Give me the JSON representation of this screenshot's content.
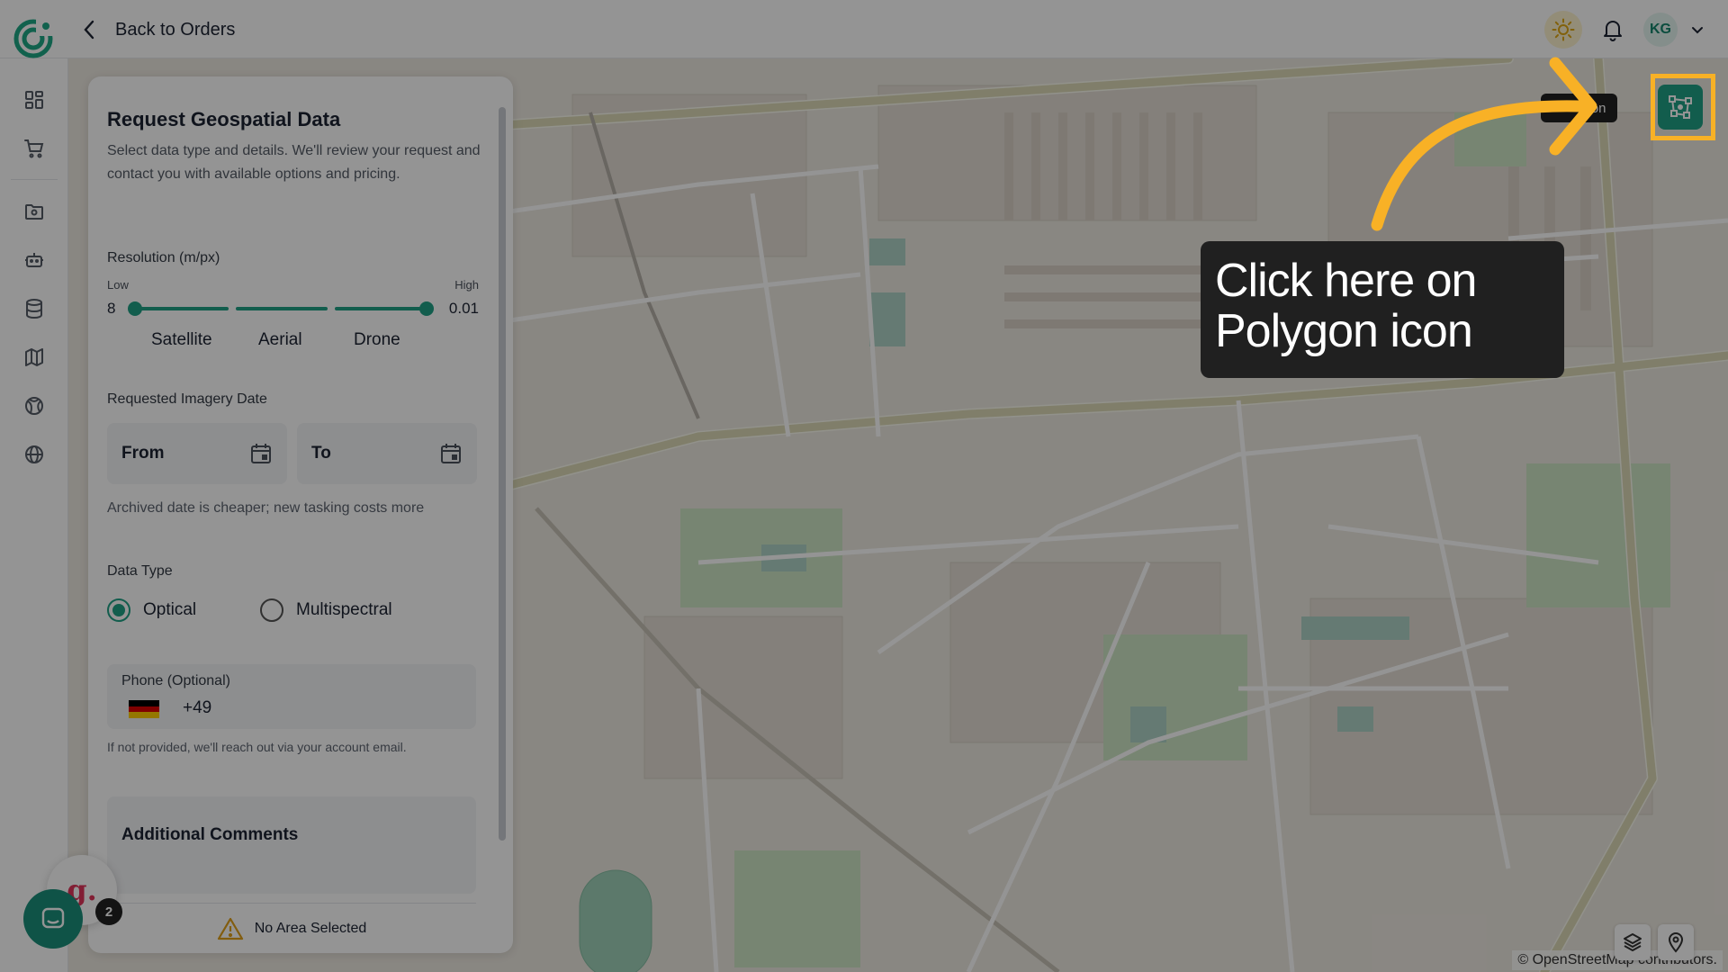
{
  "header": {
    "back_label": "Back to Orders",
    "avatar_initials": "KG"
  },
  "icons": {
    "logo": "brand-logo-icon",
    "back": "chevron-left-icon",
    "theme": "sun-icon",
    "notifications": "bell-icon",
    "account_menu": "chevron-down-icon",
    "rail": [
      "dashboard-icon",
      "cart-icon",
      "folder-icon",
      "robot-icon",
      "database-icon",
      "map-icon",
      "globe-grid-icon",
      "globe-icon"
    ],
    "polygon": "polygon-draw-icon",
    "layers": "layers-icon",
    "location": "location-pin-icon",
    "warning": "warning-icon",
    "calendar": "calendar-icon",
    "chat": "chat-icon"
  },
  "map": {
    "polygon_tooltip": "ygon",
    "attribution": "© OpenStreetMap contributors."
  },
  "panel": {
    "title": "Request Geospatial Data",
    "description": "Select data type and details. We'll review your request and contact you with available options and pricing.",
    "resolution": {
      "label": "Resolution (m/px)",
      "low_label": "Low",
      "high_label": "High",
      "min_value": "8",
      "max_value": "0.01",
      "ticks": [
        "Satellite",
        "Aerial",
        "Drone"
      ]
    },
    "imagery_date": {
      "label": "Requested Imagery Date",
      "from": "From",
      "to": "To",
      "hint": "Archived date is cheaper; new tasking costs more"
    },
    "data_type": {
      "label": "Data Type",
      "options": [
        "Optical",
        "Multispectral"
      ],
      "selected": "Optical"
    },
    "phone": {
      "label": "Phone (Optional)",
      "country_code": "+49",
      "hint": "If not provided, we'll reach out via your account email."
    },
    "comments_label": "Additional Comments",
    "footer_status": "No Area Selected"
  },
  "chat": {
    "widget_letter": "g.",
    "badge_count": "2"
  },
  "tutorial": {
    "callout_text": "Click here on Polygon icon"
  },
  "colors": {
    "accent": "#20a186",
    "highlight": "#f8b126",
    "callout_bg": "#202020"
  }
}
